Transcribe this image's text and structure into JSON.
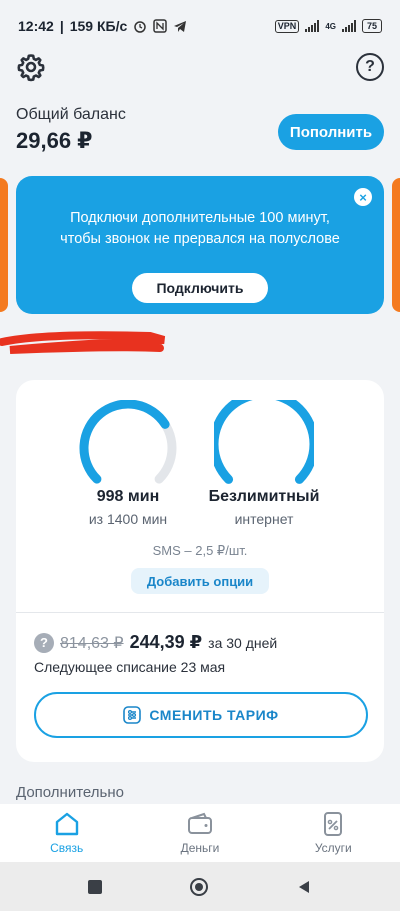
{
  "status_bar": {
    "time": "12:42",
    "speed": "159 КБ/с",
    "vpn": "VPN",
    "net": "4G",
    "battery": "75"
  },
  "header": {
    "settings_icon": "gear-icon",
    "help_icon": "question-icon",
    "help_glyph": "?"
  },
  "balance": {
    "label": "Общий баланс",
    "amount": "29,66 ₽",
    "topup_label": "Пополнить"
  },
  "promo": {
    "line1": "Подключи дополнительные 100 минут,",
    "line2": "чтобы звонок не прервался на полуслове",
    "button_label": "Подключить",
    "close_glyph": "×"
  },
  "tariff": {
    "minutes_title": "998 мин",
    "minutes_sub": "из 1400 мин",
    "minutes_remaining": 998,
    "minutes_total": 1400,
    "internet_title": "Безлимитный",
    "internet_sub": "интернет",
    "sms": "SMS – 2,5 ₽/шт.",
    "add_options_label": "Добавить опции",
    "price_hint_glyph": "?",
    "old_price": "814,63 ₽",
    "new_price": "244,39 ₽",
    "period": "за 30 дней",
    "next_charge": "Следующее списание 23 мая",
    "change_label": "СМЕНИТЬ ТАРИФ"
  },
  "section_extra": "Дополнительно",
  "tabs": [
    {
      "label": "Связь",
      "icon": "home-icon",
      "active": true
    },
    {
      "label": "Деньги",
      "icon": "wallet-icon",
      "active": false
    },
    {
      "label": "Услуги",
      "icon": "services-icon",
      "active": false
    }
  ],
  "colors": {
    "accent": "#1aa1e3",
    "orange": "#f47a1f",
    "background": "#f1f3f6"
  }
}
